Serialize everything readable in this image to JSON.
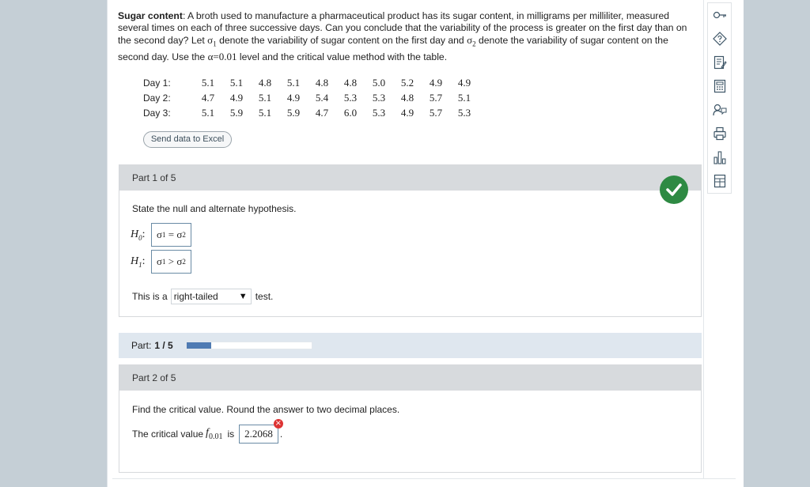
{
  "problem": {
    "title": "Sugar content",
    "text1": ": A broth used to manufacture a pharmaceutical product has its sugar content, in milligrams per milliliter, measured several times on each of three successive days. Can you conclude that the variability of the process is greater on the first day than on the second day? Let",
    "sigma1": "σ",
    "sub1": "1",
    "text2": " denote the variability of sugar content on the first day and",
    "sigma2": "σ",
    "sub2": "2",
    "text3": " denote the variability of sugar content on the second day. Use the",
    "alpha": "α=0.01",
    "text4": " level and the critical value method with the table."
  },
  "data_table": {
    "rows": [
      {
        "label": "Day 1:",
        "values": [
          "5.1",
          "5.1",
          "4.8",
          "5.1",
          "4.8",
          "4.8",
          "5.0",
          "5.2",
          "4.9",
          "4.9"
        ]
      },
      {
        "label": "Day 2:",
        "values": [
          "4.7",
          "4.9",
          "5.1",
          "4.9",
          "5.4",
          "5.3",
          "5.3",
          "4.8",
          "5.7",
          "5.1"
        ]
      },
      {
        "label": "Day 3:",
        "values": [
          "5.1",
          "5.9",
          "5.1",
          "5.9",
          "4.7",
          "6.0",
          "5.3",
          "4.9",
          "5.7",
          "5.3"
        ]
      }
    ]
  },
  "excel_button": "Send data to Excel",
  "part1": {
    "header": "Part 1 of 5",
    "instruction": "State the null and alternate hypothesis.",
    "h0_label": "H",
    "h0_sub": "0",
    "h1_label": "H",
    "h1_sub": "1",
    "colon": ":",
    "h0_expr_left": "σ",
    "h0_expr_left_sub": "1",
    "h0_op": " = ",
    "h0_expr_right": "σ",
    "h0_expr_right_sub": "2",
    "h1_expr_left": "σ",
    "h1_expr_left_sub": "1",
    "h1_op": " > ",
    "h1_expr_right": "σ",
    "h1_expr_right_sub": "2",
    "test_prefix": "This is a",
    "test_selected": "right-tailed",
    "test_suffix": "test.",
    "status": "correct"
  },
  "progress": {
    "label": "Part:",
    "value": "1 / 5",
    "fraction": 0.2,
    "color": "#4f7bb3"
  },
  "part2": {
    "header": "Part 2 of 5",
    "instruction": "Find the critical value. Round the answer to two decimal places.",
    "crit_prefix": "The critical value",
    "f_symbol": "f",
    "f_sub": "0.01",
    "crit_is": "is",
    "answer": "2.2068",
    "period": ".",
    "status": "incorrect"
  },
  "toolbar": {
    "icons": [
      "key-icon",
      "question-help-icon",
      "notepad-icon",
      "calculator-icon",
      "tutor-icon",
      "print-icon",
      "chart-icon",
      "table-icon"
    ]
  }
}
